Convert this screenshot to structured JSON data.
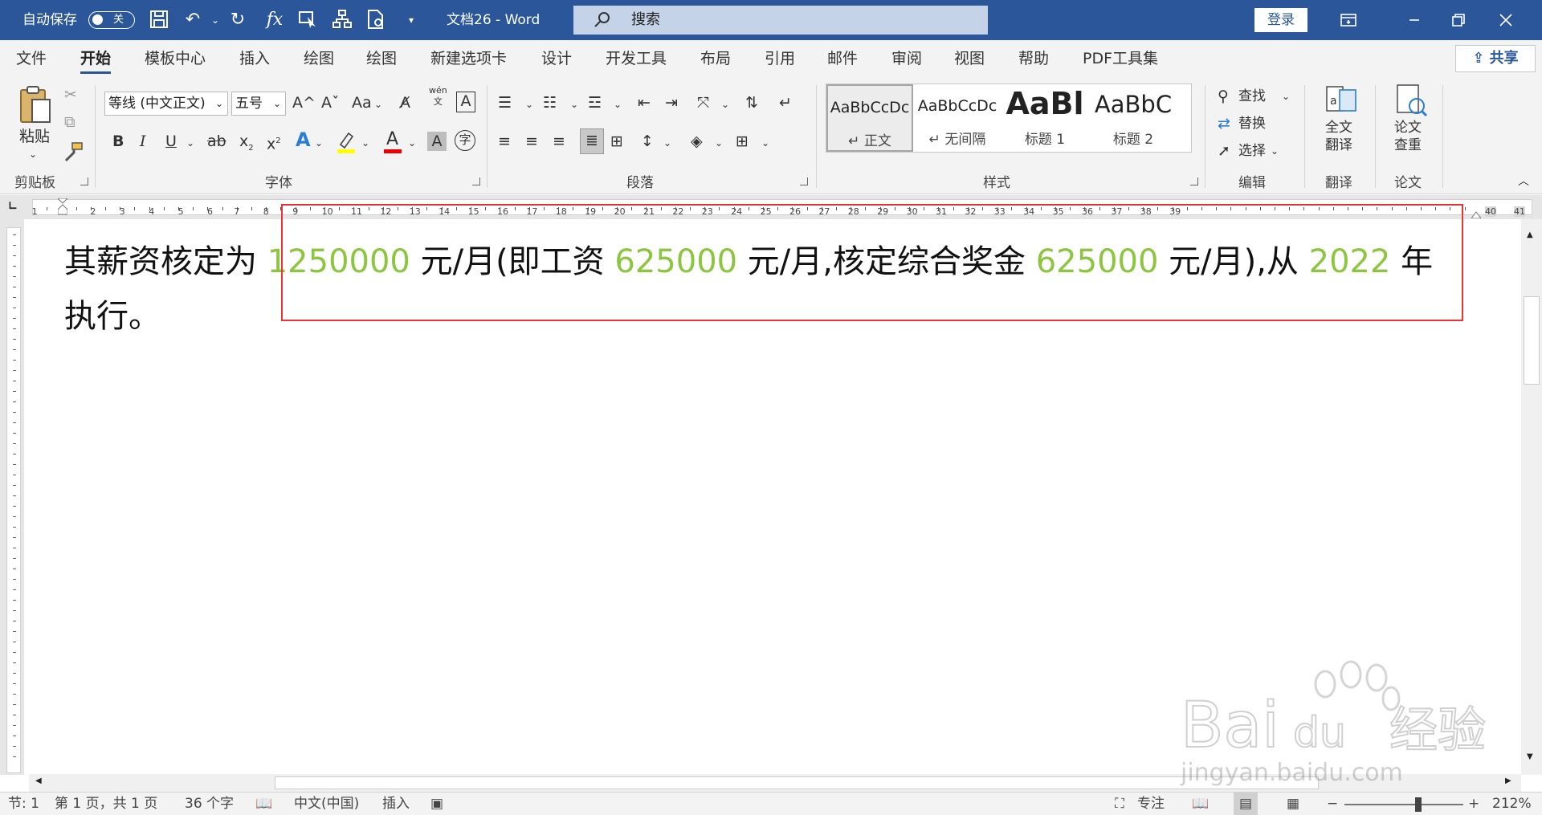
{
  "titlebar": {
    "autosave_label": "自动保存",
    "autosave_state": "关",
    "doc_title": "文档26  -  Word",
    "search_placeholder": "搜索",
    "login_label": "登录"
  },
  "tabs": [
    "文件",
    "开始",
    "模板中心",
    "插入",
    "绘图",
    "绘图",
    "新建选项卡",
    "设计",
    "开发工具",
    "布局",
    "引用",
    "邮件",
    "审阅",
    "视图",
    "帮助",
    "PDF工具集"
  ],
  "active_tab": "开始",
  "share_label": "共享",
  "ribbon": {
    "clipboard": {
      "paste_label": "粘贴",
      "group_label": "剪贴板"
    },
    "font": {
      "font_name": "等线 (中文正文)",
      "font_size": "五号",
      "grow": "A^",
      "shrink": "Aˇ",
      "case": "Aa",
      "wen": "wén",
      "wen_sub": "文",
      "border_char": "A",
      "bold": "B",
      "italic": "I",
      "underline": "U",
      "strike": "ab",
      "subscript": "x",
      "superscript": "x",
      "text_effect": "A",
      "font_color": "A",
      "shading_char": "A",
      "enclose_char": "字",
      "group_label": "字体"
    },
    "paragraph": {
      "group_label": "段落"
    },
    "styles": {
      "items": [
        {
          "preview": "AaBbCcDc",
          "name": "↵ 正文"
        },
        {
          "preview": "AaBbCcDc",
          "name": "↵ 无间隔"
        },
        {
          "preview": "AaBl",
          "name": "标题 1"
        },
        {
          "preview": "AaBbC",
          "name": "标题 2"
        }
      ],
      "group_label": "样式"
    },
    "editing": {
      "find": "查找",
      "replace": "替换",
      "select": "选择",
      "group_label": "编辑"
    },
    "translate": {
      "button": "全文\n翻译",
      "line1": "全文",
      "line2": "翻译",
      "group_label": "翻译"
    },
    "paper": {
      "line1": "论文",
      "line2": "查重",
      "group_label": "论文"
    }
  },
  "ruler": {
    "left_labels": [
      "1",
      "1",
      "2",
      "3",
      "4",
      "5",
      "6"
    ],
    "labels": [
      "7",
      "8",
      "9",
      "10",
      "11",
      "12",
      "13",
      "14",
      "15",
      "16",
      "17",
      "18",
      "19",
      "20",
      "21",
      "22",
      "23",
      "24",
      "25",
      "26",
      "27",
      "28",
      "29",
      "30",
      "31",
      "32",
      "33",
      "34",
      "35",
      "36",
      "37",
      "38",
      "39"
    ],
    "right_labels": [
      "40",
      "41"
    ]
  },
  "document": {
    "line1": [
      {
        "text": "其薪资核定为 ",
        "green": false
      },
      {
        "text": "1250000",
        "green": true
      },
      {
        "text": " 元/月(即工资 ",
        "green": false
      },
      {
        "text": "625000",
        "green": true
      },
      {
        "text": " 元/月,核定综合奖金 ",
        "green": false
      },
      {
        "text": "625000",
        "green": true
      },
      {
        "text": " 元/月),从 ",
        "green": false
      },
      {
        "text": "2022",
        "green": true
      },
      {
        "text": " 年",
        "green": false
      }
    ],
    "line2": "执行。"
  },
  "status": {
    "section": "节: 1",
    "page": "第 1 页，共 1 页",
    "words": "36 个字",
    "language": "中文(中国)",
    "mode": "插入",
    "focus": "专注",
    "zoom": "212%"
  },
  "watermark": {
    "brand": "Bai",
    "brand2": "du",
    "cn": "经验",
    "url": "jingyan.baidu.com"
  },
  "colors": {
    "accent": "#2b579a",
    "green_text": "#8cc63f",
    "highlight_border": "#e33333"
  }
}
